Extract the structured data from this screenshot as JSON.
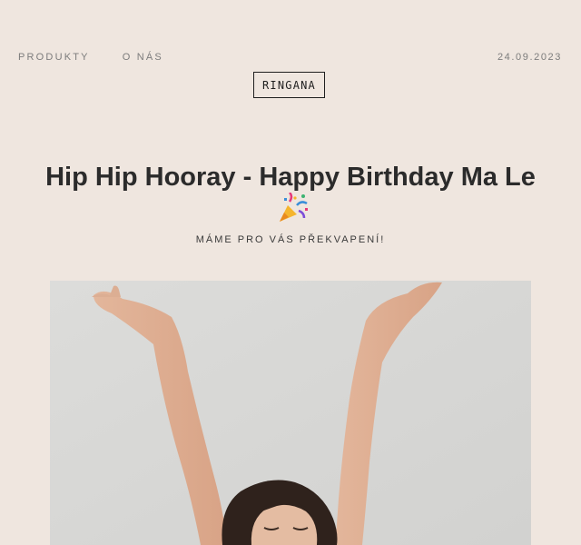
{
  "nav": {
    "items": [
      {
        "label": "PRODUKTY"
      },
      {
        "label": "O NÁS"
      }
    ],
    "date": "24.09.2023"
  },
  "logo": {
    "text": "RINGANA"
  },
  "headline": {
    "text": "Hip Hip Hooray - Happy Birthday Ma Le",
    "icon": "party-popper-icon"
  },
  "subtitle": {
    "text": "MÁME PRO VÁS PŘEKVAPENÍ!"
  },
  "hero_image": {
    "subject": "woman-raising-arms"
  },
  "colors": {
    "background": "#efe6df",
    "text": "#2b2b2b",
    "nav_text": "#7c7c7c",
    "photo_background": "#d9d9d7"
  }
}
